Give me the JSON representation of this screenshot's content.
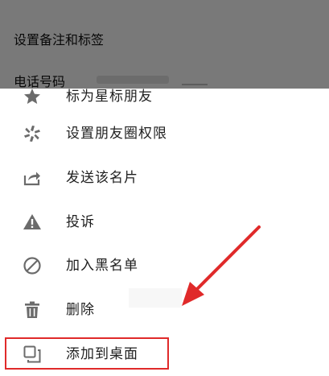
{
  "background": {
    "rows": [
      {
        "label": "设置备注和标签"
      },
      {
        "label": "电话号码"
      }
    ]
  },
  "menu": {
    "items": [
      {
        "label": "标为星标朋友",
        "icon": "star-icon"
      },
      {
        "label": "设置朋友圈权限",
        "icon": "aperture-icon"
      },
      {
        "label": "发送该名片",
        "icon": "share-icon"
      },
      {
        "label": "投诉",
        "icon": "warning-icon"
      },
      {
        "label": "加入黑名单",
        "icon": "block-icon"
      },
      {
        "label": "删除",
        "icon": "trash-icon"
      },
      {
        "label": "添加到桌面",
        "icon": "add-to-desktop-icon"
      }
    ]
  },
  "colors": {
    "annotation_red": "#e02a2a",
    "icon_gray": "#6b6b6b"
  }
}
